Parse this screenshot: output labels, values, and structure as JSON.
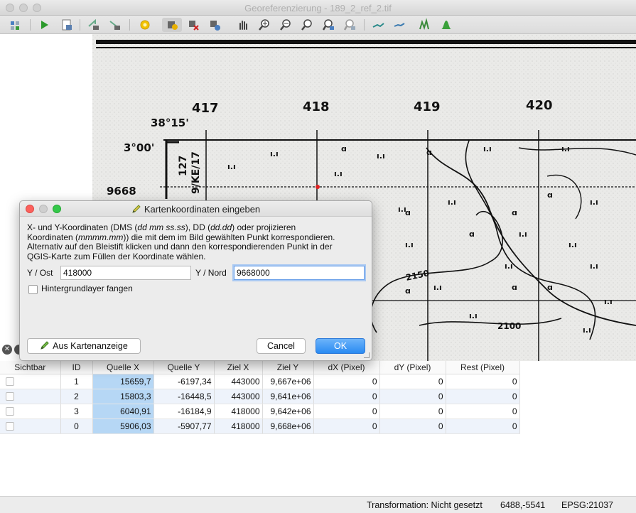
{
  "window": {
    "title": "Georeferenzierung - 189_2_ref_2.tif"
  },
  "map": {
    "col_labels": [
      "417",
      "418",
      "419",
      "420"
    ],
    "lat_label": "38°15'",
    "lon_label": "3°00'",
    "row_label": "9668",
    "sheet_label": "9/KE/17",
    "sheet_num": "127",
    "contour_1": "2150",
    "contour_2": "2100"
  },
  "dialog": {
    "title": "Kartenkoordinaten eingeben",
    "line1_a": "X- und Y-Koordinaten (DMS (",
    "line1_b": "dd mm ss.ss",
    "line1_c": "), DD (",
    "line1_d": "dd.dd",
    "line1_e": ") oder projizieren",
    "line2_a": "Koordinaten (",
    "line2_b": "mmmm.mm",
    "line2_c": ")) die mit dem im Bild gewählten Punkt korrespondieren.",
    "line3": "Alternativ auf den Bleistift klicken und dann den korrespondierenden Punkt in der",
    "line4": "QGIS-Karte zum Füllen der Koordinate wählen.",
    "y_ost_label": "Y / Ost",
    "y_ost_value": "418000",
    "y_nord_label": "Y / Nord",
    "y_nord_value": "9668000",
    "snap_label": "Hintergrundlayer fangen",
    "from_map_label": "Aus Kartenanzeige",
    "cancel_label": "Cancel",
    "ok_label": "OK"
  },
  "gcp_table": {
    "headers": [
      "Sichtbar",
      "ID",
      "Quelle X",
      "Quelle Y",
      "Ziel X",
      "Ziel Y",
      "dX (Pixel)",
      "dY (Pixel)",
      "Rest (Pixel)"
    ],
    "rows": [
      {
        "id": "1",
        "qx": "15659,7",
        "qy": "-6197,34",
        "zx": "443000",
        "zy": "9,667e+06",
        "dx": "0",
        "dy": "0",
        "rest": "0"
      },
      {
        "id": "2",
        "qx": "15803,3",
        "qy": "-16448,5",
        "zx": "443000",
        "zy": "9,641e+06",
        "dx": "0",
        "dy": "0",
        "rest": "0"
      },
      {
        "id": "3",
        "qx": "6040,91",
        "qy": "-16184,9",
        "zx": "418000",
        "zy": "9,642e+06",
        "dx": "0",
        "dy": "0",
        "rest": "0"
      },
      {
        "id": "0",
        "qx": "5906,03",
        "qy": "-5907,77",
        "zx": "418000",
        "zy": "9,668e+06",
        "dx": "0",
        "dy": "0",
        "rest": "0"
      }
    ]
  },
  "status": {
    "transformation": "Transformation: Nicht gesetzt",
    "coords": "6488,-5541",
    "crs": "EPSG:21037"
  },
  "colors": {
    "accent": "#2a8bf2",
    "selection": "#b6d7f5",
    "gcp_marker": "#e02020"
  }
}
